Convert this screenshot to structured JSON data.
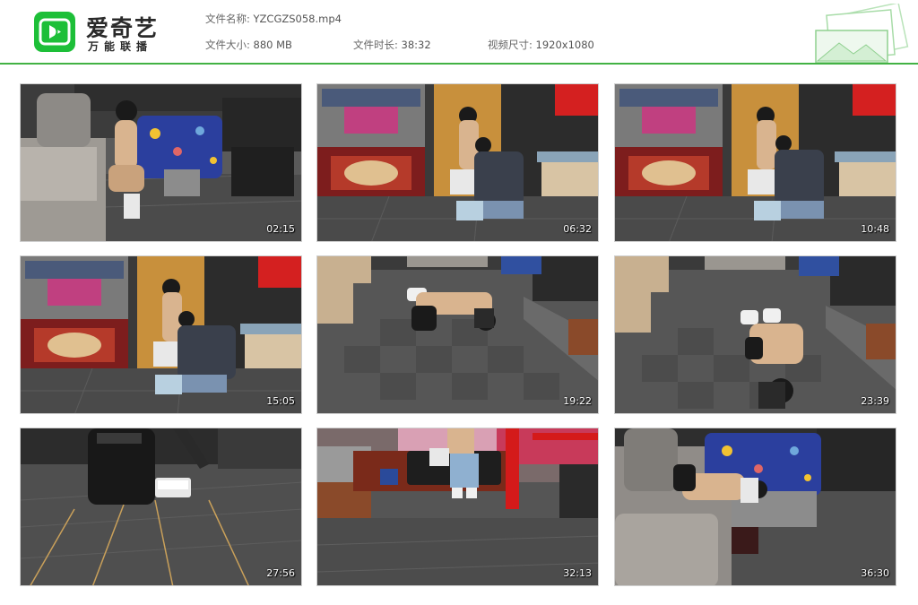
{
  "brand": {
    "title": "爱奇艺",
    "subtitle": "万能联播",
    "color": "#1dbf38"
  },
  "file_info": {
    "name_label": "文件名称:",
    "name_value": "YZCGZS058.mp4",
    "size_label": "文件大小:",
    "size_value": "880 MB",
    "duration_label": "文件时长:",
    "duration_value": "38:32",
    "dimensions_label": "视频尺寸:",
    "dimensions_value": "1920x1080"
  },
  "accent_color": "#43b244",
  "thumbnails": [
    {
      "timestamp": "02:15",
      "scene": "sofa"
    },
    {
      "timestamp": "06:32",
      "scene": "door"
    },
    {
      "timestamp": "10:48",
      "scene": "door"
    },
    {
      "timestamp": "15:05",
      "scene": "door"
    },
    {
      "timestamp": "19:22",
      "scene": "floor"
    },
    {
      "timestamp": "23:39",
      "scene": "floor"
    },
    {
      "timestamp": "27:56",
      "scene": "closeup"
    },
    {
      "timestamp": "32:13",
      "scene": "room"
    },
    {
      "timestamp": "36:30",
      "scene": "sofa2"
    }
  ]
}
